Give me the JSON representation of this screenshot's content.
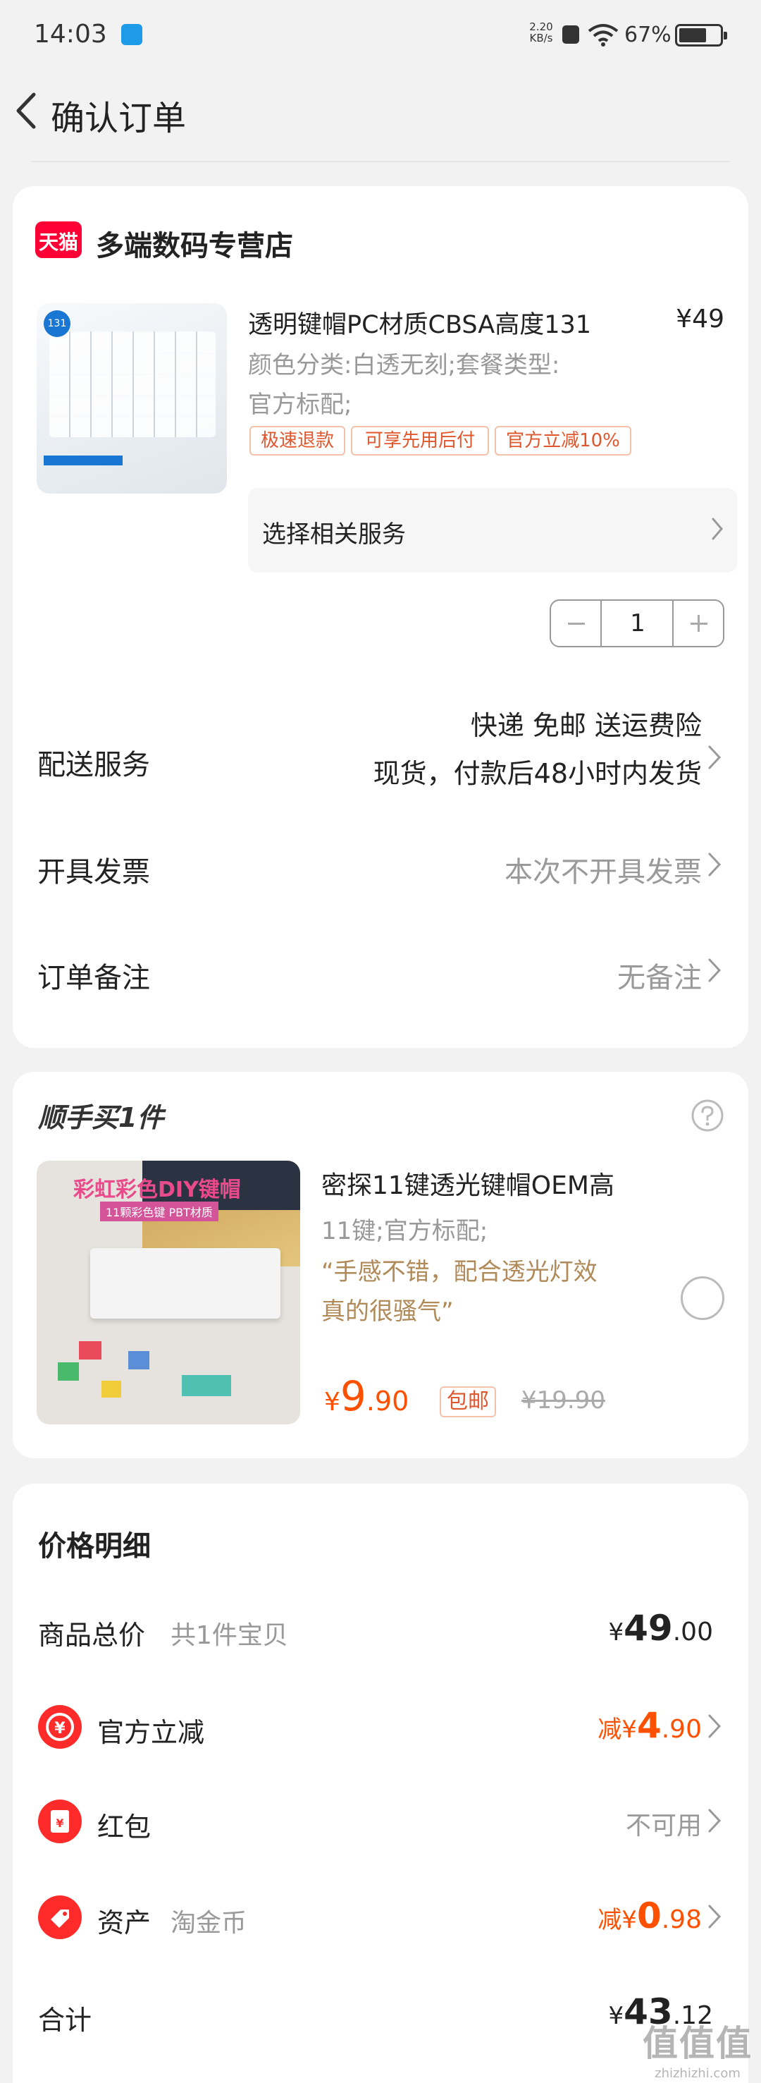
{
  "status": {
    "time": "14:03",
    "speed_value": "2.20",
    "speed_unit": "KB/s",
    "battery": "67%",
    "battery_level": 0.67
  },
  "header": {
    "title": "确认订单"
  },
  "shop": {
    "badge": "天猫",
    "name": "多端数码专营店"
  },
  "product": {
    "badge": "131",
    "title": "透明键帽PC材质CBSA高度131",
    "price": "¥49",
    "spec_line1": "颜色分类:白透无刻;套餐类型:",
    "spec_line2": "官方标配;",
    "tags": [
      "极速退款",
      "可享先用后付",
      "官方立减10%"
    ],
    "service_label": "选择相关服务",
    "quantity": "1"
  },
  "delivery": {
    "label": "配送服务",
    "line1": "快递 免邮 送运费险",
    "line2": "现货，付款后48小时内发货"
  },
  "invoice": {
    "label": "开具发票",
    "value": "本次不开具发票"
  },
  "note": {
    "label": "订单备注",
    "value": "无备注"
  },
  "addon": {
    "title": "顺手买1件",
    "product_title": "密探11键透光键帽OEM高",
    "spec": "11键;官方标配;",
    "quote_line1": "“手感不错，配合透光灯效",
    "quote_line2": "真的很骚气”",
    "price_symbol": "¥",
    "price_int": "9",
    "price_dec": ".90",
    "free_ship": "包邮",
    "original_price": "¥19.90",
    "image_title": "彩虹彩色DIY键帽",
    "image_sub": "11颗彩色键 PBT材质"
  },
  "price_detail": {
    "title": "价格明细",
    "total_label": "商品总价",
    "total_count": "共1件宝贝",
    "total_symbol": "¥",
    "total_int": "49",
    "total_dec": ".00",
    "discount_label": "官方立减",
    "discount_prefix": "减¥",
    "discount_int": "4",
    "discount_dec": ".90",
    "redpacket_label": "红包",
    "redpacket_value": "不可用",
    "asset_label": "资产",
    "asset_sub": "淘金币",
    "asset_prefix": "减¥",
    "asset_int": "0",
    "asset_dec": ".98",
    "sum_label": "合计",
    "sum_symbol": "¥",
    "sum_int": "43",
    "sum_dec": ".12"
  },
  "watermark": {
    "text": "值值值",
    "sub": "zhizhizhi.com"
  },
  "colors": {
    "accent": "#ff5000",
    "tmall_red": "#ff0036",
    "tag_border": "#f4c2a8",
    "text_gray": "#999999"
  },
  "icons": {
    "back": "chevron-left-icon",
    "help": "question-circle-icon",
    "discount": "yuan-circle-icon",
    "redpacket": "red-envelope-icon",
    "asset": "tag-icon"
  }
}
